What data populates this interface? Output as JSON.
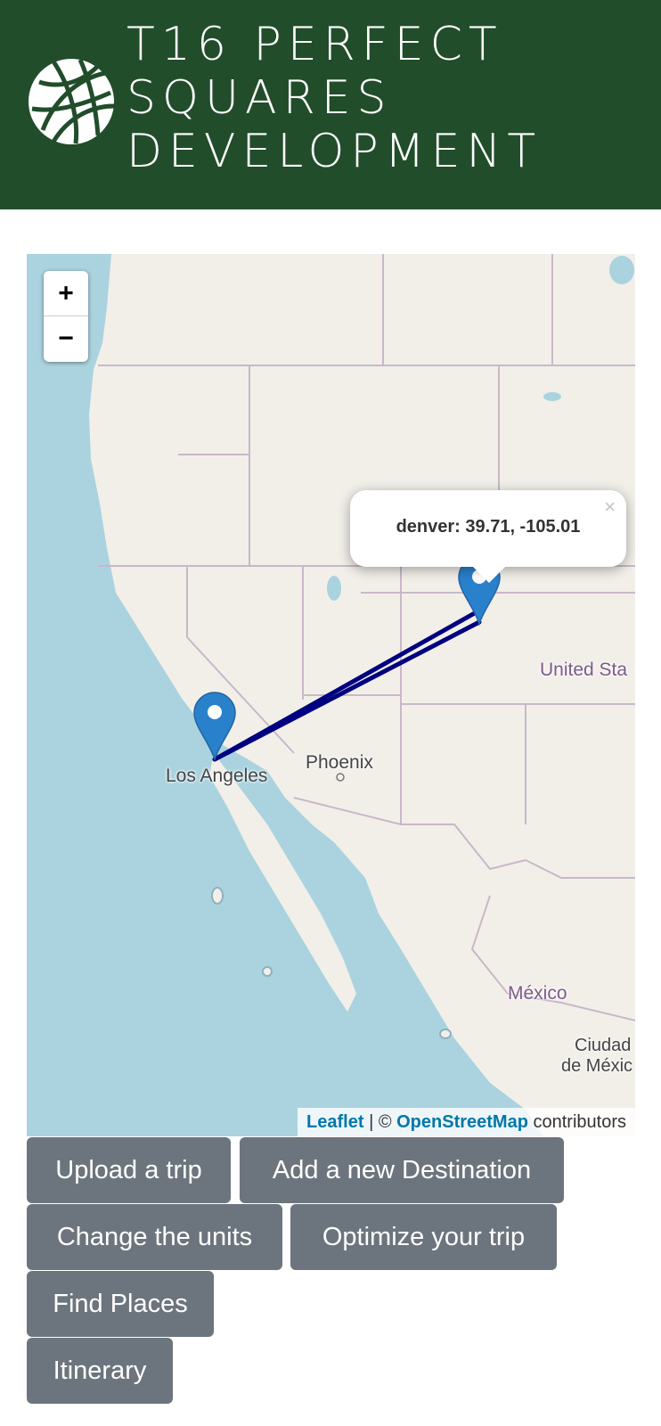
{
  "header": {
    "title": "T16 PERFECT SQUARES DEVELOPMENT"
  },
  "map": {
    "zoom_in": "+",
    "zoom_out": "−",
    "popup": {
      "text": "denver: 39.71, -105.01",
      "close": "×"
    },
    "labels": {
      "los_angeles": "Los Angeles",
      "phoenix": "Phoenix",
      "united_states": "United Sta",
      "mexico": "México",
      "ciudad": "Ciudad",
      "de_mexico": "de Méxic"
    },
    "markers": [
      {
        "name": "los-angeles-marker",
        "lat": 34.05,
        "lng": -118.24
      },
      {
        "name": "denver-marker",
        "lat": 39.71,
        "lng": -105.01
      }
    ],
    "route_color": "#000080",
    "marker_color": "#2a81cb",
    "attribution": {
      "leaflet": "Leaflet",
      "separator": " | © ",
      "osm": "OpenStreetMap",
      "suffix": " contributors"
    }
  },
  "buttons": {
    "upload": "Upload a trip",
    "add_destination": "Add a new Destination",
    "change_units": "Change the units",
    "optimize": "Optimize your trip",
    "find_places": "Find Places",
    "itinerary": "Itinerary"
  },
  "colors": {
    "header_bg": "#214d2b",
    "button_bg": "#6c757d",
    "water": "#aad3df",
    "land": "#f2efe9"
  }
}
